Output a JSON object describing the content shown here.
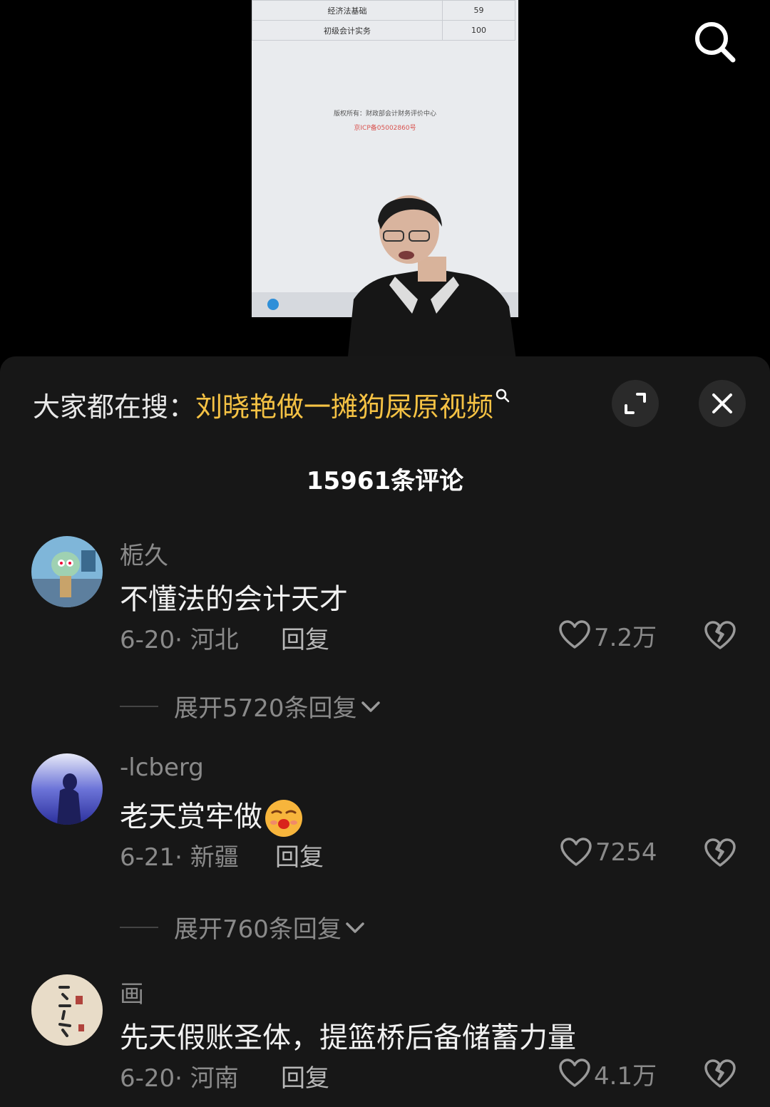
{
  "video": {
    "table_rows": [
      {
        "subject": "经济法基础",
        "score": "59"
      },
      {
        "subject": "初级会计实务",
        "score": "100"
      }
    ],
    "copyright": "版权所有：财政部会计财务评价中心",
    "icp": "京ICP备05002860号"
  },
  "sheet": {
    "hot_prefix": "大家都在搜：",
    "hot_keyword": "刘晓艳做一摊狗屎原视频",
    "comment_count": "15961条评论"
  },
  "comments": [
    {
      "username": "栀久",
      "text": "不懂法的会计天才",
      "meta": "6-20· 河北",
      "reply_label": "回复",
      "likes": "7.2万",
      "expand": "展开5720条回复"
    },
    {
      "username": "-lcberg",
      "text": "老天赏牢做",
      "meta": "6-21· 新疆",
      "reply_label": "回复",
      "likes": "7254",
      "expand": "展开760条回复"
    },
    {
      "username": "画",
      "text": "先天假账圣体，提篮桥后备储蓄力量",
      "meta": "6-20· 河南",
      "reply_label": "回复",
      "likes": "4.1万"
    }
  ],
  "colors": {
    "accent_keyword": "#f5c244",
    "sheet_bg": "#171717",
    "muted_text": "#8a8a8a"
  },
  "icons": [
    "search-icon",
    "expand-icon",
    "close-icon",
    "heart-icon",
    "dislike-icon",
    "chevron-down-icon"
  ]
}
